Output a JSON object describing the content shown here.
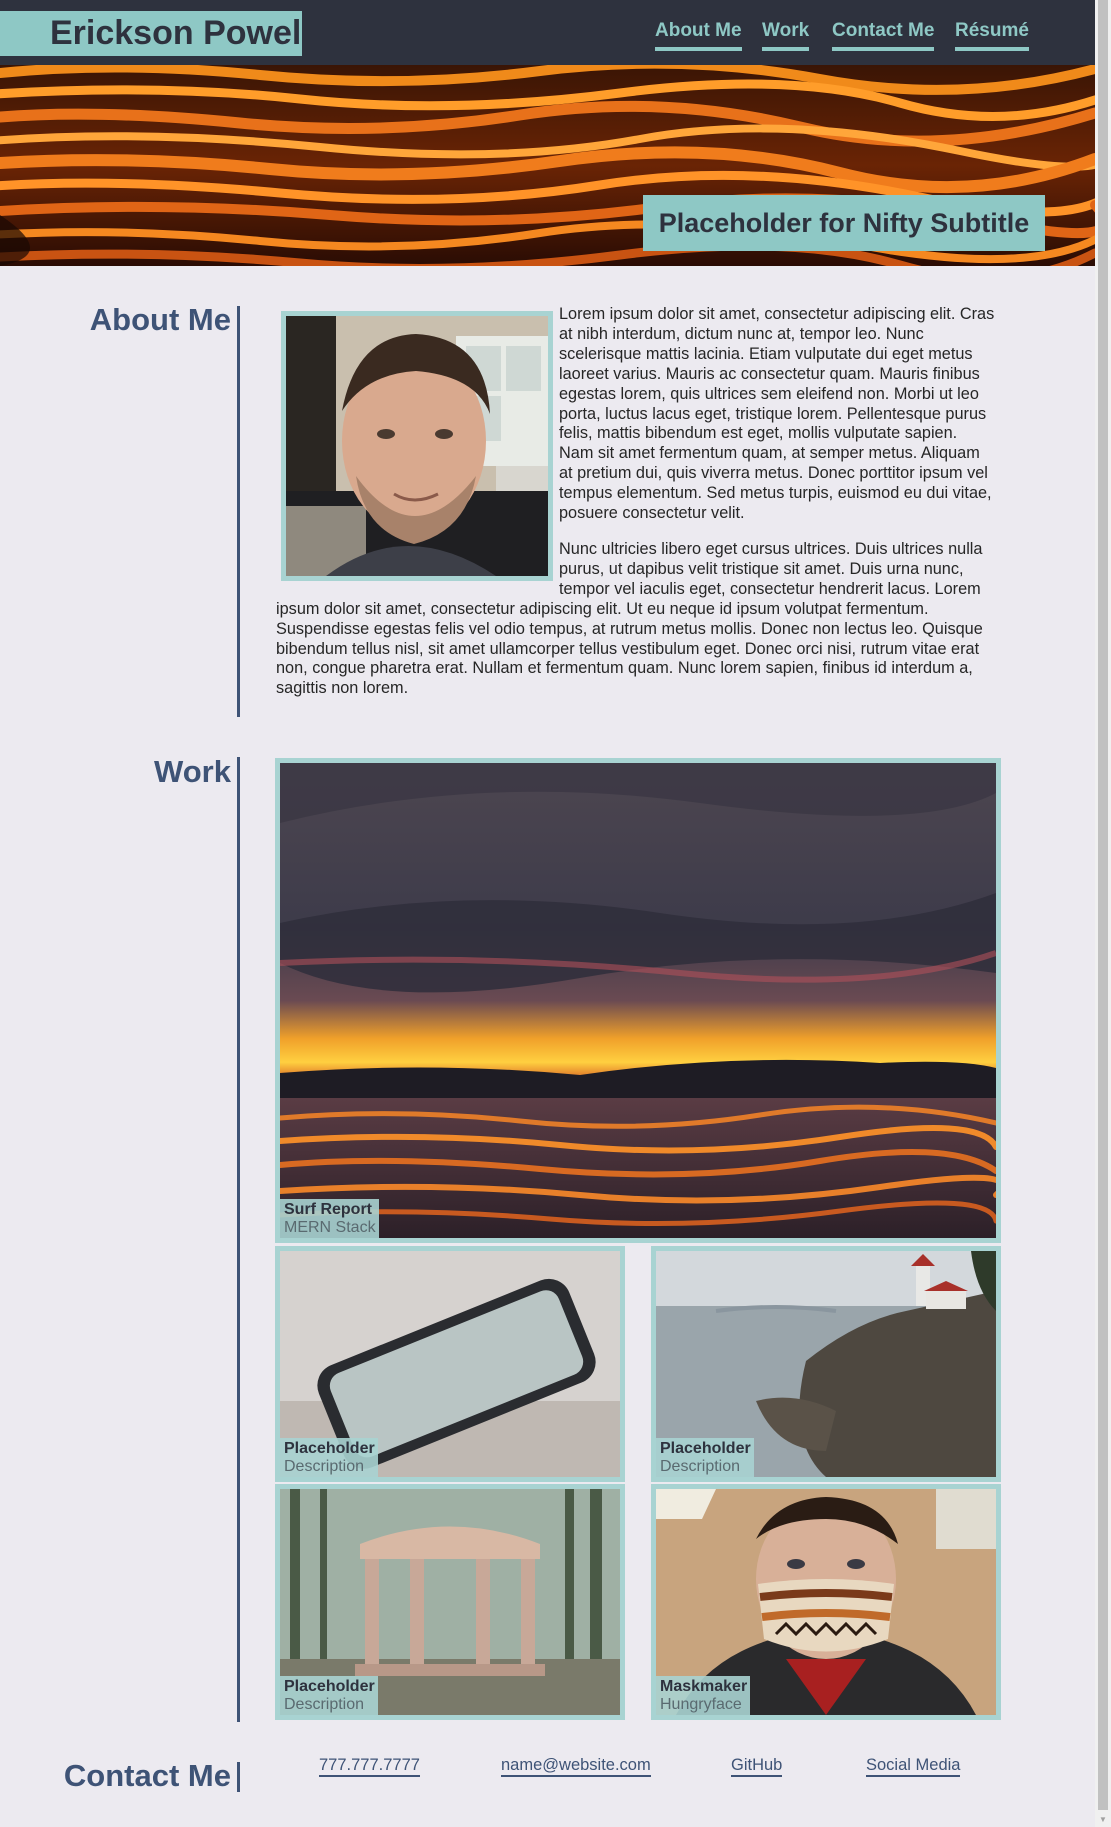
{
  "header": {
    "brand": "Erickson Powell",
    "nav": [
      {
        "label": "About Me"
      },
      {
        "label": "Work"
      },
      {
        "label": "Contact Me"
      },
      {
        "label": "Résumé"
      }
    ],
    "subtitle": "Placeholder for Nifty Subtitle"
  },
  "about": {
    "title": "About Me",
    "paragraphs": [
      "Lorem ipsum dolor sit amet, consectetur adipiscing elit. Cras at nibh interdum, dictum nunc at, tempor leo. Nunc scelerisque mattis lacinia. Etiam vulputate dui eget metus laoreet varius. Mauris ac consectetur quam. Mauris finibus egestas lorem, quis ultrices sem eleifend non. Morbi ut leo porta, luctus lacus eget, tristique lorem. Pellentesque purus felis, mattis bibendum est eget, mollis vulputate sapien. Nam sit amet fermentum quam, at semper metus. Aliquam at pretium dui, quis viverra metus. Donec porttitor ipsum vel tempus elementum. Sed metus turpis, euismod eu dui vitae, posuere consectetur velit.",
      "Nunc ultricies libero eget cursus ultrices. Duis ultrices nulla purus, ut dapibus velit tristique sit amet. Duis urna nunc, tempor vel iaculis eget, consectetur hendrerit lacus. Lorem ipsum dolor sit amet, consectetur adipiscing elit. Ut eu neque id ipsum volutpat fermentum. Suspendisse egestas felis vel odio tempus, at rutrum metus mollis. Donec non lectus leo. Quisque bibendum tellus nisl, sit amet ullamcorper tellus vestibulum eget. Donec orci nisi, rutrum vitae erat non, congue pharetra erat. Nullam et fermentum quam. Nunc lorem sapien, finibus id interdum a, sagittis non lorem."
    ]
  },
  "work": {
    "title": "Work",
    "projects": [
      {
        "title": "Surf Report",
        "subtitle": "MERN Stack"
      },
      {
        "title": "Placeholder",
        "subtitle": "Description"
      },
      {
        "title": "Placeholder",
        "subtitle": "Description"
      },
      {
        "title": "Placeholder",
        "subtitle": "Description"
      },
      {
        "title": "Maskmaker",
        "subtitle": "Hungryface"
      }
    ]
  },
  "contact": {
    "title": "Contact Me",
    "links": [
      {
        "label": "777.777.7777"
      },
      {
        "label": "name@website.com"
      },
      {
        "label": "GitHub"
      },
      {
        "label": "Social Media"
      }
    ]
  }
}
